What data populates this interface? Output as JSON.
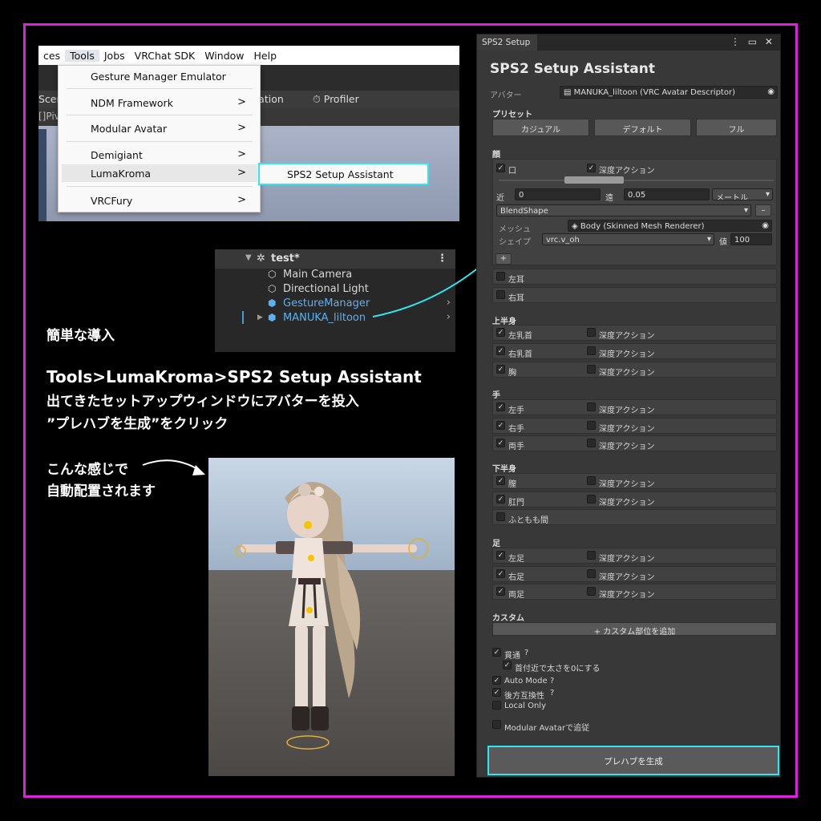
{
  "menu": {
    "bar": [
      "ces",
      "Tools",
      "Jobs",
      "VRChat SDK",
      "Window",
      "Help"
    ],
    "toolbar_left": "Scen",
    "toolbar_mid": "mation",
    "toolbar_profiler": "Profiler",
    "pivot": "[]Piv",
    "items": [
      {
        "label": "Gesture Manager Emulator",
        "arrow": ""
      },
      {
        "label": "NDM Framework",
        "arrow": ">"
      },
      {
        "label": "Modular Avatar",
        "arrow": ">"
      },
      {
        "label": "Demigiant",
        "arrow": ">"
      },
      {
        "label": "LumaKroma",
        "arrow": ">"
      },
      {
        "label": "VRCFury",
        "arrow": ">"
      }
    ],
    "submenu": "SPS2 Setup Assistant"
  },
  "hierarchy": {
    "scene": "test*",
    "dots": "⋮",
    "rows": [
      {
        "name": "Main Camera"
      },
      {
        "name": "Directional Light"
      },
      {
        "name": "GestureManager"
      },
      {
        "name": "MANUKA_liltoon"
      }
    ]
  },
  "texts": {
    "intro": "簡単な導入",
    "path": "Tools>LumaKroma>SPS2 Setup Assistant",
    "line2": "出てきたセットアップウィンドウにアバターを投入",
    "line3": "”プレハブを生成”をクリック",
    "line4": "こんな感じで",
    "line5": "自動配置されます"
  },
  "panel": {
    "tab": "SPS2 Setup",
    "tab_icons": "⋮ ▭ ✕",
    "title": "SPS2 Setup Assistant",
    "avatar_label": "アバター",
    "avatar_value": "MANUKA_liltoon (VRC Avatar Descriptor)",
    "preset_label": "プリセット",
    "presets": [
      "カジュアル",
      "デフォルト",
      "フル"
    ],
    "face": {
      "section": "顔",
      "mouth": "口",
      "depth_action": "深度アクション",
      "near_label": "近",
      "near_value": "0",
      "far_label": "遠",
      "far_value": "0.05",
      "unit": "メートル",
      "blend": "BlendShape",
      "minus": "–",
      "mesh_label": "メッシュ",
      "mesh_value": "Body (Skinned Mesh Renderer)",
      "shape_label": "シェイプ",
      "shape_value": "vrc.v_oh",
      "val_label": "値",
      "val_value": "100",
      "plus": "+",
      "left_ear": "左耳",
      "right_ear": "右耳"
    },
    "upper": {
      "section": "上半身",
      "items": [
        "左乳首",
        "右乳首",
        "胸"
      ]
    },
    "hands": {
      "section": "手",
      "items": [
        "左手",
        "右手",
        "両手"
      ]
    },
    "lower": {
      "section": "下半身",
      "items": [
        "膣",
        "肛門"
      ],
      "extra": "ふともも間"
    },
    "feet": {
      "section": "足",
      "items": [
        "左足",
        "右足",
        "両足"
      ]
    },
    "custom": {
      "section": "カスタム",
      "add": "+ カスタム部位を追加"
    },
    "options": {
      "penetrate": "貫通",
      "neck": "首付近で太さを0にする",
      "auto": "Auto Mode",
      "compat": "後方互換性",
      "local": "Local Only",
      "modular": "Modular Avatarで追従",
      "help": "?"
    },
    "generate": "プレハブを生成"
  },
  "colors": {
    "frame": "#e020e0",
    "highlight": "#31e6f0",
    "panel_bg": "#383838",
    "hier_blue": "#5cb2f0"
  }
}
